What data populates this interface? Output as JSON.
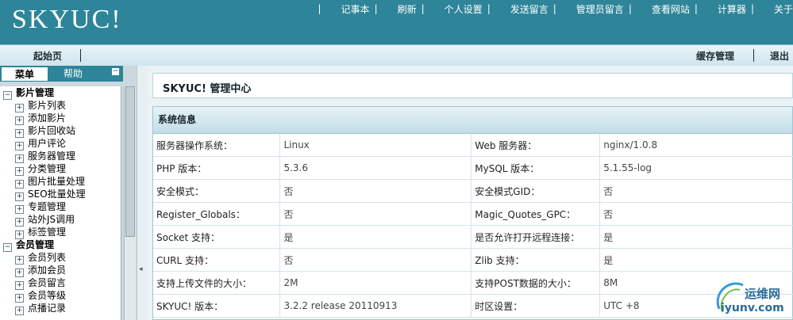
{
  "header": {
    "logo": "SKYUC!",
    "nav": [
      "记事本",
      "刷新",
      "个人设置",
      "发送留言",
      "管理员留言",
      "查看网站",
      "计算器",
      "关于"
    ]
  },
  "bar2": {
    "home": "起始页",
    "cache": "缓存管理",
    "logout": "退出"
  },
  "left_tabs": {
    "menu": "菜单",
    "help": "帮助",
    "toggle": "−"
  },
  "menu": [
    {
      "group": "影片管理",
      "expanded": "−",
      "items": [
        "影片列表",
        "添加影片",
        "影片回收站",
        "用户评论",
        "服务器管理",
        "分类管理",
        "图片批量处理",
        "SEO批量处理",
        "专题管理",
        "站外JS调用",
        "标签管理"
      ]
    },
    {
      "group": "会员管理",
      "expanded": "−",
      "items": [
        "会员列表",
        "添加会员",
        "会员留言",
        "会员等级",
        "点播记录"
      ]
    }
  ],
  "tree_item_marker": "+",
  "collapse_arrow": "◂",
  "main": {
    "title": "SKYUC! 管理中心",
    "panel_title": "系统信息",
    "rows": [
      [
        "服务器操作系统：",
        "Linux",
        "Web 服务器：",
        "nginx/1.0.8"
      ],
      [
        "PHP 版本：",
        "5.3.6",
        "MySQL 版本：",
        "5.1.55-log"
      ],
      [
        "安全模式：",
        "否",
        "安全模式GID：",
        "否"
      ],
      [
        "Register_Globals：",
        "否",
        "Magic_Quotes_GPC：",
        "否"
      ],
      [
        "Socket 支持：",
        "是",
        "是否允许打开远程连接：",
        "是"
      ],
      [
        "CURL 支持：",
        "否",
        "Zlib 支持：",
        "是"
      ],
      [
        "支持上传文件的大小：",
        "2M",
        "支持POST数据的大小：",
        "8M"
      ],
      [
        "SKYUC! 版本：",
        "3.2.2 release 20110913",
        "时区设置：",
        "UTC +8"
      ]
    ]
  },
  "watermark": {
    "cn": "运维网",
    "url": "iyunv.com"
  }
}
